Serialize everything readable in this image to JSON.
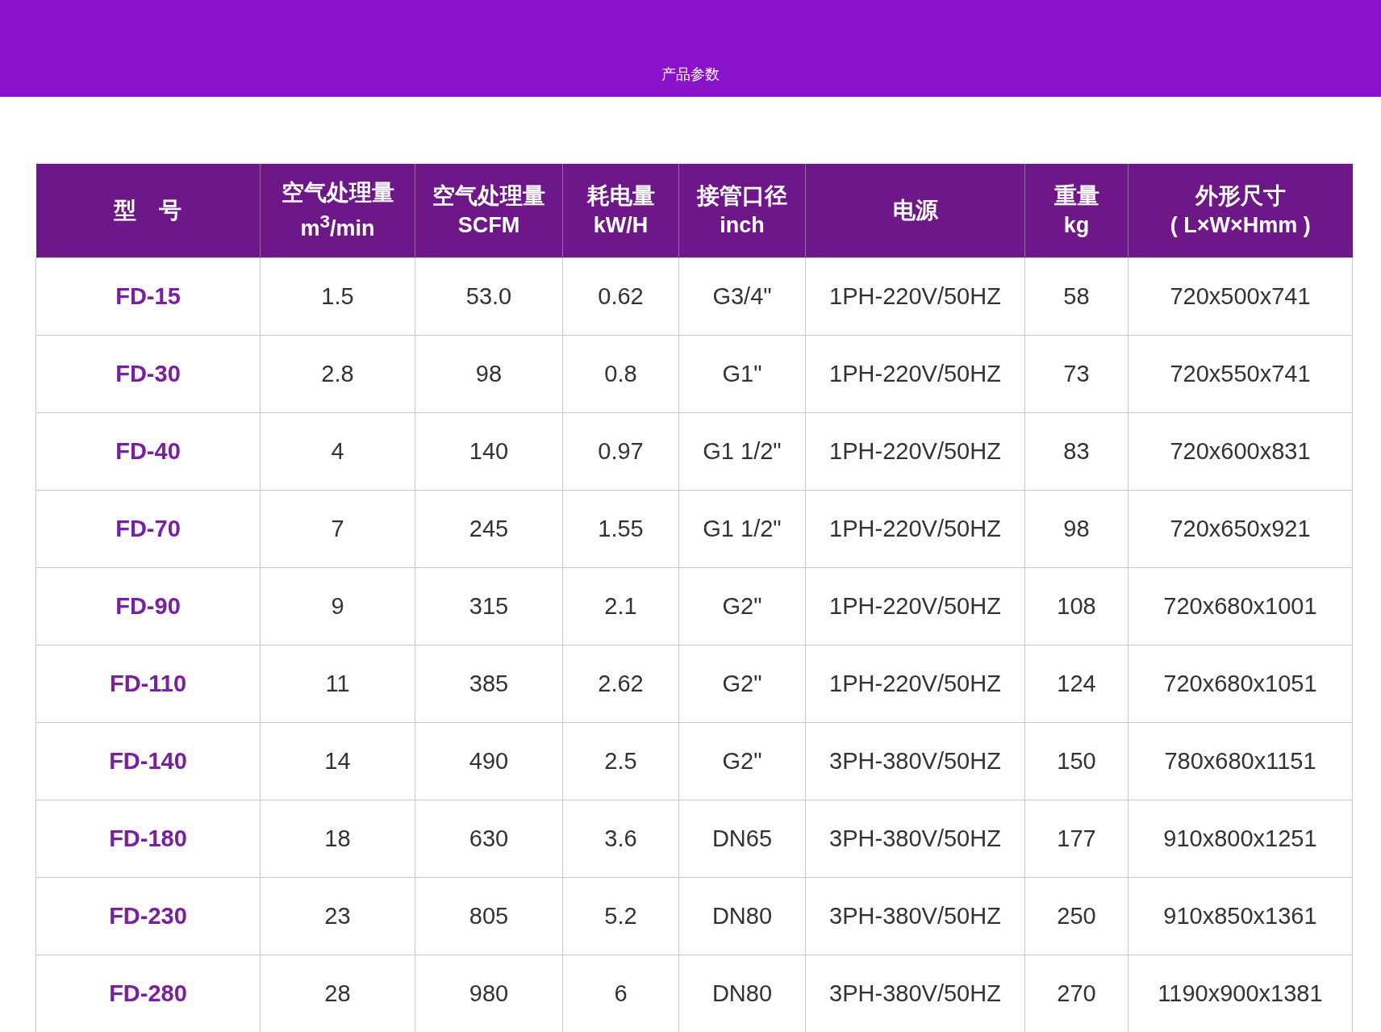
{
  "banner": {
    "title": "产品参数"
  },
  "table": {
    "columns": [
      {
        "title": "型　号"
      },
      {
        "title": "空气处理量",
        "unit": "m$^{3}$/min"
      },
      {
        "title": "空气处理量",
        "unit": "SCFM"
      },
      {
        "title": "耗电量",
        "unit": "kW/H"
      },
      {
        "title": "接管口径",
        "unit": "inch"
      },
      {
        "title": "电源"
      },
      {
        "title": "重量",
        "unit": "kg"
      },
      {
        "title": "外形尺寸",
        "unit": "( L×W×Hmm )"
      }
    ],
    "rows": [
      [
        "FD-15",
        "1.5",
        "53.0",
        "0.62",
        "G3/4\"",
        "1PH-220V/50HZ",
        "58",
        "720x500x741"
      ],
      [
        "FD-30",
        "2.8",
        "98",
        "0.8",
        "G1\"",
        "1PH-220V/50HZ",
        "73",
        "720x550x741"
      ],
      [
        "FD-40",
        "4",
        "140",
        "0.97",
        "G1 1/2\"",
        "1PH-220V/50HZ",
        "83",
        "720x600x831"
      ],
      [
        "FD-70",
        "7",
        "245",
        "1.55",
        "G1 1/2\"",
        "1PH-220V/50HZ",
        "98",
        "720x650x921"
      ],
      [
        "FD-90",
        "9",
        "315",
        "2.1",
        "G2\"",
        "1PH-220V/50HZ",
        "108",
        "720x680x1001"
      ],
      [
        "FD-110",
        "11",
        "385",
        "2.62",
        "G2\"",
        "1PH-220V/50HZ",
        "124",
        "720x680x1051"
      ],
      [
        "FD-140",
        "14",
        "490",
        "2.5",
        "G2\"",
        "3PH-380V/50HZ",
        "150",
        "780x680x1151"
      ],
      [
        "FD-180",
        "18",
        "630",
        "3.6",
        "DN65",
        "3PH-380V/50HZ",
        "177",
        "910x800x1251"
      ],
      [
        "FD-230",
        "23",
        "805",
        "5.2",
        "DN80",
        "3PH-380V/50HZ",
        "250",
        "910x850x1361"
      ],
      [
        "FD-280",
        "28",
        "980",
        "6",
        "DN80",
        "3PH-380V/50HZ",
        "270",
        "1190x900x1381"
      ]
    ]
  }
}
